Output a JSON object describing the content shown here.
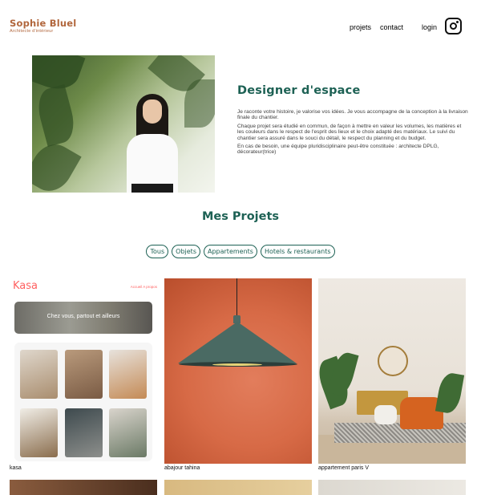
{
  "header": {
    "brand_name": "Sophie Bluel",
    "brand_subtitle": "Architecte d'intérieur",
    "nav": {
      "projets": "projets",
      "contact": "contact",
      "login": "login"
    }
  },
  "intro": {
    "title": "Designer d'espace",
    "paragraphs": [
      "Je raconte votre histoire, je valorise vos idées. Je vous accompagne de la conception à la livraison finale du chantier.",
      "Chaque projet sera étudié en commun, de façon à mettre en valeur les volumes, les matières et les couleurs dans le respect de l'esprit des lieux et le choix adapté des matériaux. Le suivi du chantier sera assuré dans le souci du détail, le respect du planning et du budget.",
      "En cas de besoin, une équipe pluridisciplinaire peut-être constituée : architecte DPLG, décorateur(trice)"
    ]
  },
  "projects": {
    "title": "Mes Projets",
    "filters": [
      "Tous",
      "Objets",
      "Appartements",
      "Hotels & restaurants"
    ],
    "works": [
      {
        "caption": "kasa"
      },
      {
        "caption": "abajour tahina"
      },
      {
        "caption": "appartement paris V"
      }
    ]
  },
  "kasa_mock": {
    "logo": "Kasa",
    "nav": "Accueil   A propos",
    "banner": "Chez vous, partout et ailleurs"
  },
  "colors": {
    "brand": "#b1663c",
    "accent": "#1d6154",
    "kasa": "#ff6060"
  }
}
